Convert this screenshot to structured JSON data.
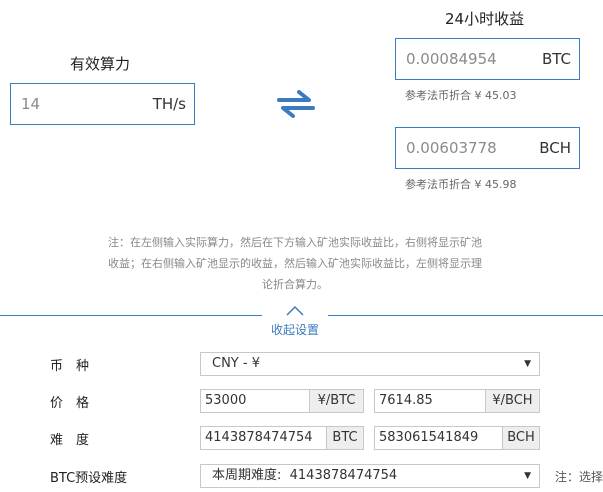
{
  "hashrate": {
    "title": "有效算力",
    "value": "14",
    "unit": "TH/s"
  },
  "income": {
    "title": "24小时收益",
    "btc": {
      "value": "0.00084954",
      "unit": "BTC",
      "ref": "参考法币折合 ¥ 45.03"
    },
    "bch": {
      "value": "0.00603778",
      "unit": "BCH",
      "ref": "参考法币折合 ¥ 45.98"
    }
  },
  "swap_icon": "swap-arrows-icon",
  "note": {
    "line1": "注：在左侧输入实际算力，然后在下方输入矿池实际收益比，右侧将显示矿池",
    "line2": "收益；在右侧输入矿池显示的收益，然后输入矿池实际收益比，左侧将显示理",
    "line3": "论折合算力。"
  },
  "collapse": {
    "label": "收起设置"
  },
  "settings": {
    "currency": {
      "label": "币　种",
      "selected": "CNY - ¥"
    },
    "price": {
      "label": "价　格",
      "btc_value": "53000",
      "btc_unit": "¥/BTC",
      "bch_value": "7614.85",
      "bch_unit": "¥/BCH"
    },
    "difficulty": {
      "label": "难　度",
      "btc_value": "4143878474754",
      "btc_unit": "BTC",
      "bch_value": "583061541849",
      "bch_unit": "BCH"
    },
    "btc_preset": {
      "label": "BTC预设难度",
      "selected": "本周期难度:  4143878474754",
      "hint": "注：选择"
    }
  },
  "colors": {
    "accent": "#3b7bbf"
  }
}
